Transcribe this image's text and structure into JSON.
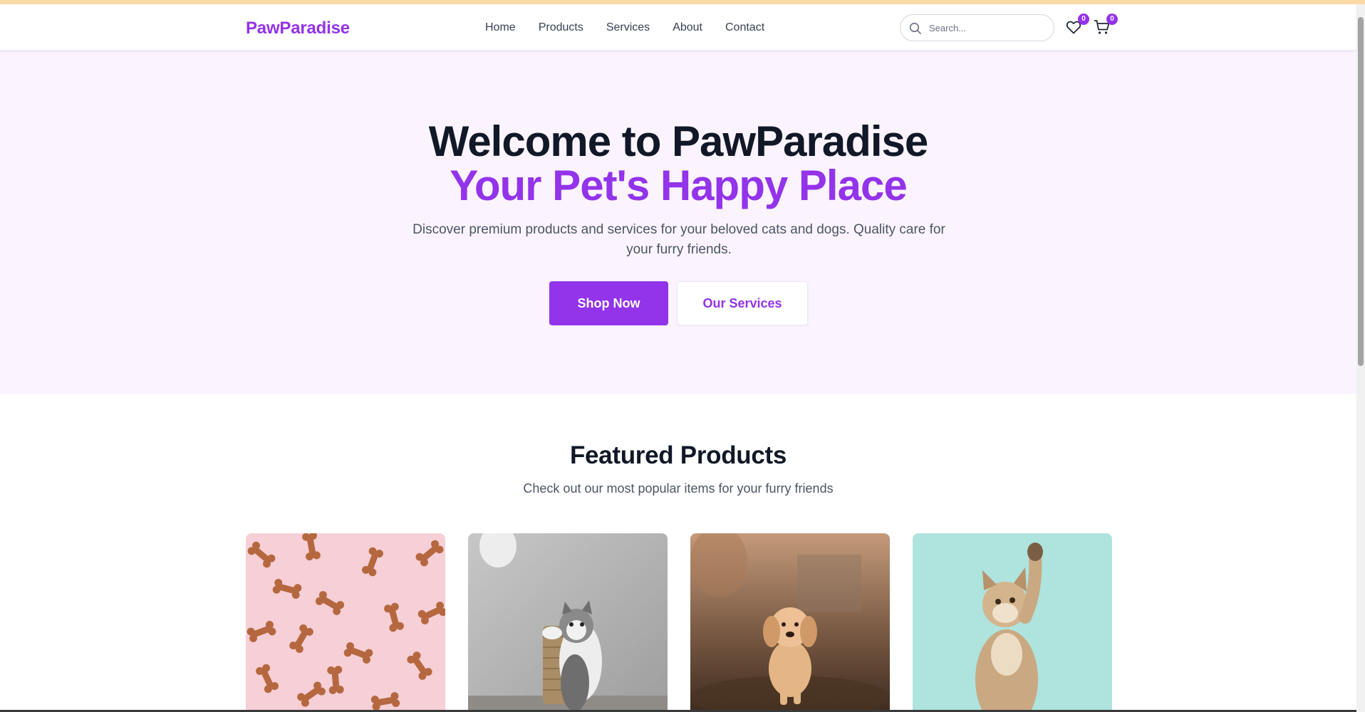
{
  "brand": {
    "name": "PawParadise",
    "accent": "#9333ea"
  },
  "nav": {
    "links": [
      {
        "label": "Home"
      },
      {
        "label": "Products"
      },
      {
        "label": "Services"
      },
      {
        "label": "About"
      },
      {
        "label": "Contact"
      }
    ]
  },
  "search": {
    "placeholder": "Search..."
  },
  "header_icons": {
    "wishlist": {
      "icon": "heart-icon",
      "count": "0"
    },
    "cart": {
      "icon": "cart-icon",
      "count": "0"
    }
  },
  "hero": {
    "title_line1": "Welcome to PawParadise",
    "title_line2": "Your Pet's Happy Place",
    "subtitle": "Discover premium products and services for your beloved cats and dogs. Quality care for your furry friends.",
    "primary_button": "Shop Now",
    "secondary_button": "Our Services",
    "background": "#fbf4fe"
  },
  "featured": {
    "title": "Featured Products",
    "subtitle": "Check out our most popular items for your furry friends",
    "products": [
      {
        "image": "dog-bone-treats-photo"
      },
      {
        "image": "kitten-scratching-post-photo"
      },
      {
        "image": "golden-retriever-puppy-photo"
      },
      {
        "image": "kitten-reaching-up-photo"
      }
    ]
  }
}
